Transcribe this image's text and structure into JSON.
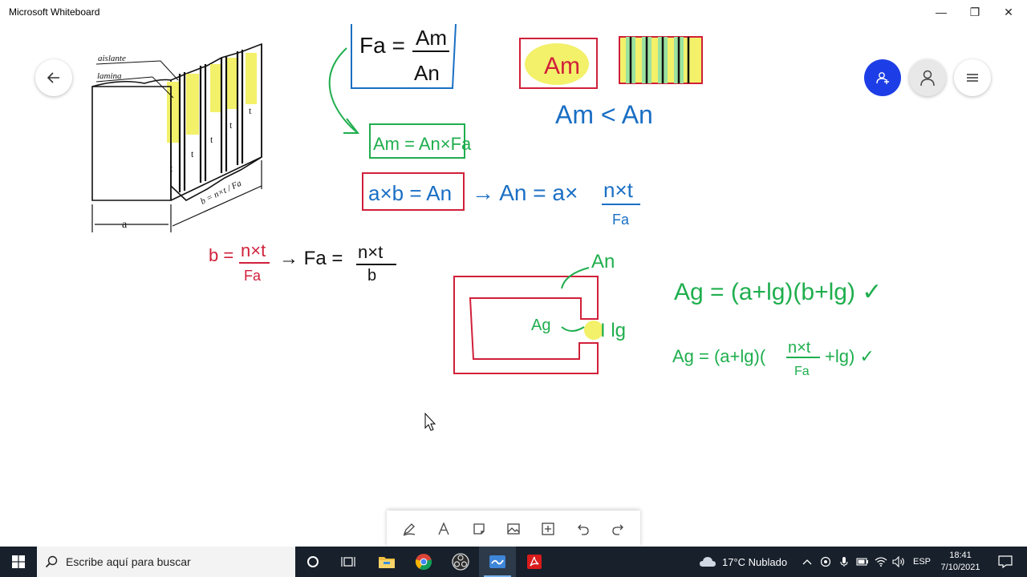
{
  "window": {
    "title": "Microsoft Whiteboard",
    "minimize_glyph": "—",
    "maximize_glyph": "❐",
    "close_glyph": "✕"
  },
  "board": {
    "diagram_labels": {
      "insulator": "aislante",
      "lamina": "lamina",
      "t": "t",
      "a": "a",
      "b_eq": "b = n×t / Fa"
    },
    "formula_fa": {
      "lhs": "Fa =",
      "num": "Am",
      "den": "An"
    },
    "box_am": "Am",
    "compare": "Am < An",
    "formula_am": "Am = An×Fa",
    "formula_axb": "a×b = An",
    "formula_an": {
      "lhs": "→ An = a×",
      "num": "n×t",
      "den": "Fa"
    },
    "formula_b": {
      "lhs": "b =",
      "num": "n×t",
      "den": "Fa"
    },
    "formula_fa2": {
      "lhs": "→ Fa =",
      "num": "n×t",
      "den": "b"
    },
    "label_an": "An",
    "label_ag": "Ag",
    "label_lg": "I lg",
    "formula_ag1": "Ag = (a+lg)(b+lg) ✓",
    "formula_ag2": {
      "lhs": "Ag = (a+lg)(",
      "num": "n×t",
      "den": "Fa",
      "rhs": "+lg) ✓"
    },
    "colors": {
      "blue": "#1a6fc4",
      "green": "#1fae4e",
      "red": "#d0203a",
      "black": "#111111",
      "highlight": "#f3f06a"
    }
  },
  "floating_buttons": {
    "back": "back-arrow-icon",
    "invite": "add-person-icon",
    "account": "person-icon",
    "menu": "hamburger-icon"
  },
  "toolbar": {
    "tools": [
      "pen-icon",
      "text-icon",
      "note-icon",
      "image-icon",
      "insert-icon",
      "undo-icon",
      "redo-icon"
    ]
  },
  "taskbar": {
    "search_placeholder": "Escribe aquí para buscar",
    "weather": "17°C  Nublado",
    "language": "ESP",
    "time": "18:41",
    "date": "7/10/2021",
    "apps": [
      "cortana-icon",
      "task-view-icon",
      "file-explorer-icon",
      "chrome-icon",
      "obs-icon",
      "whiteboard-icon",
      "acrobat-icon"
    ]
  }
}
